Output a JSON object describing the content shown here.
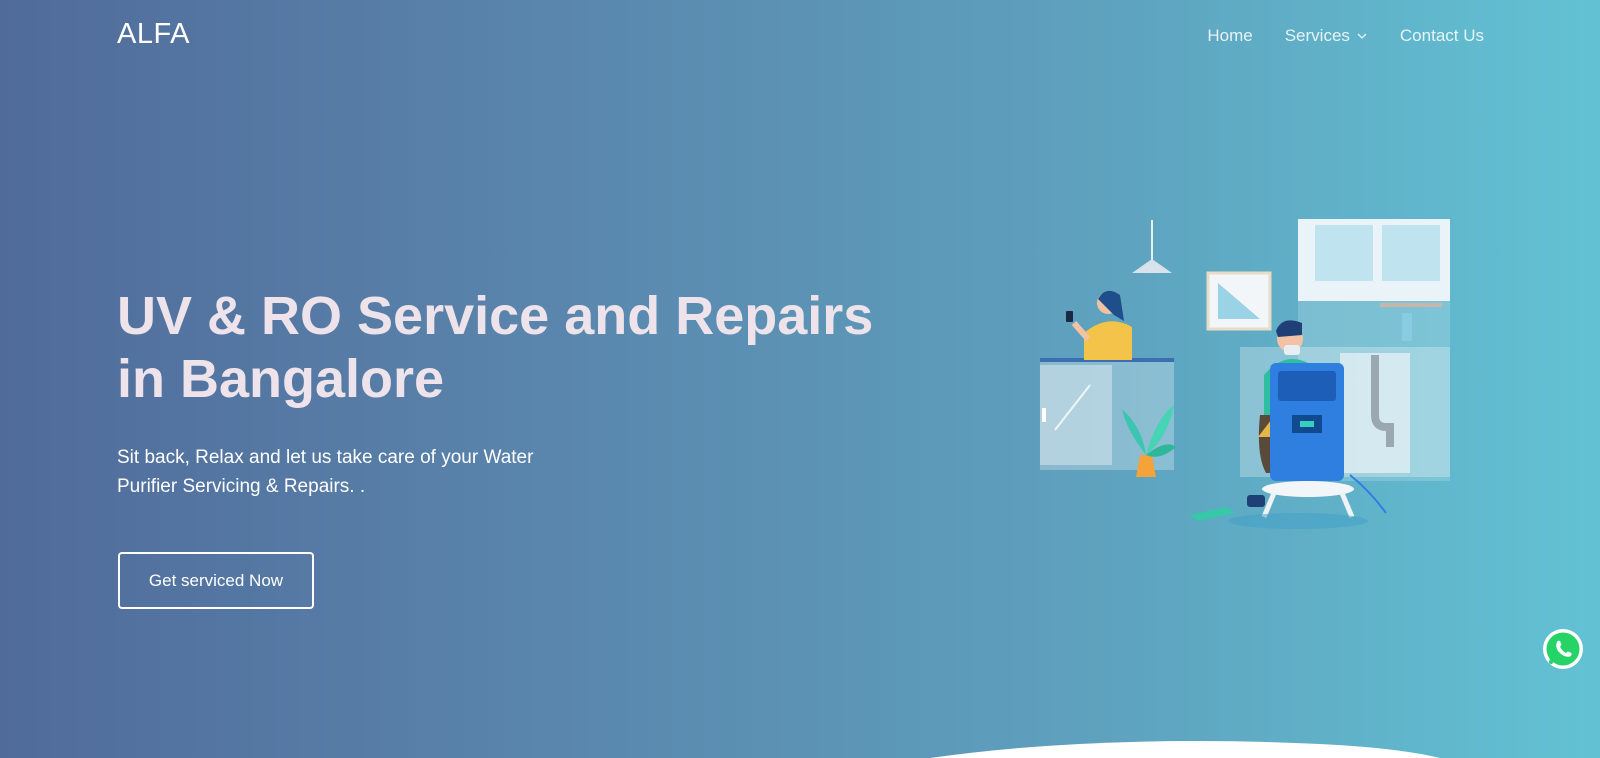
{
  "brand": {
    "logo_text": "ALFA"
  },
  "nav": {
    "items": [
      {
        "label": "Home"
      },
      {
        "label": "Services",
        "icon": "chevron-down-icon"
      },
      {
        "label": "Contact Us"
      }
    ]
  },
  "hero": {
    "title_line1": "UV & RO Service and Repairs",
    "title_line2": "in Bangalore",
    "subtitle_line1": "Sit back, Relax and let us take care of your Water",
    "subtitle_line2": "Purifier Servicing & Repairs. .",
    "cta_label": "Get serviced Now"
  },
  "floating": {
    "whatsapp_icon": "whatsapp-icon"
  },
  "colors": {
    "bg_left": "#506b9a",
    "bg_right": "#62c2d4",
    "title": "#eee3ea",
    "whatsapp": "#25d366"
  }
}
